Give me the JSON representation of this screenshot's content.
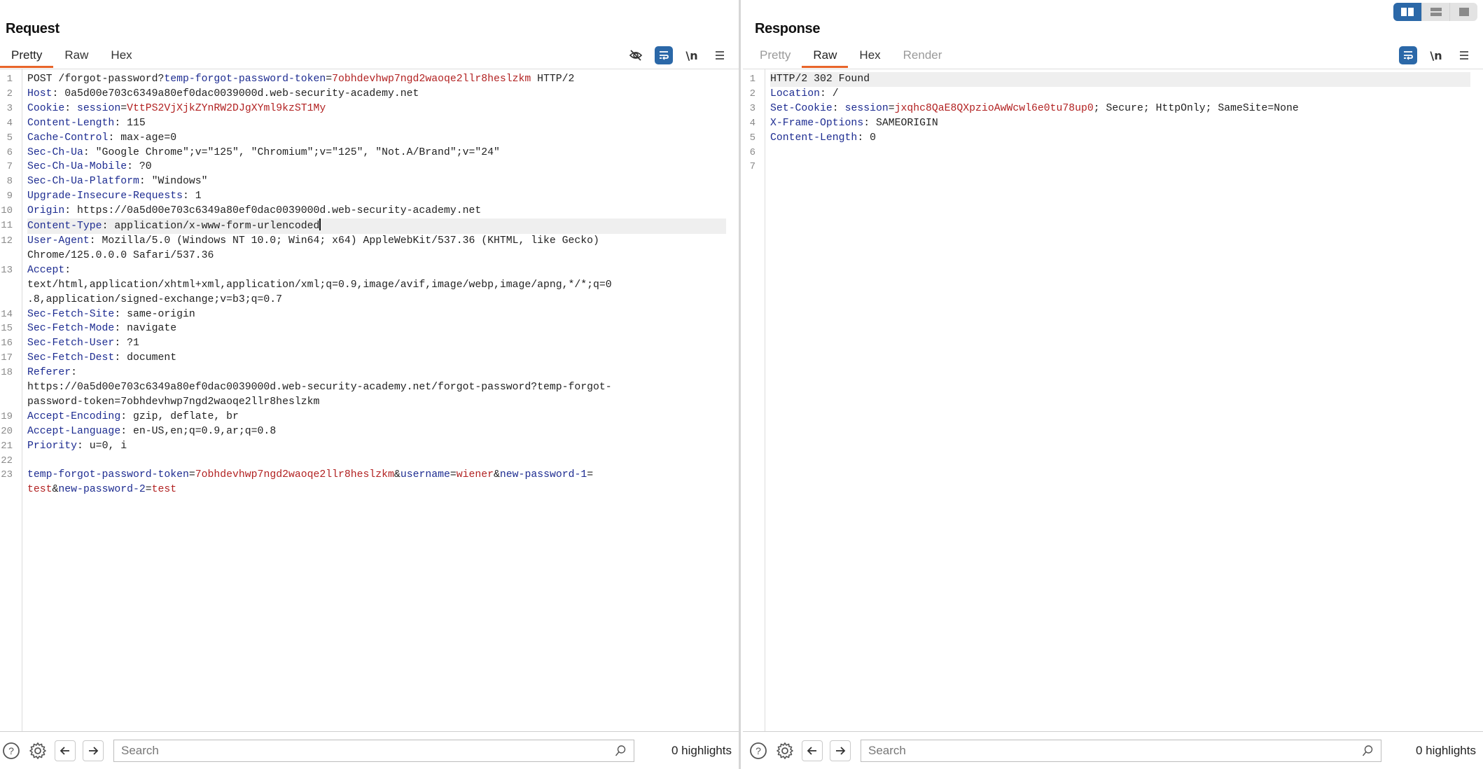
{
  "layout_toggle": {
    "options": [
      "side-by-side",
      "stacked-horizontal",
      "single"
    ],
    "active": "side-by-side"
  },
  "request": {
    "title": "Request",
    "tabs": [
      {
        "label": "Pretty",
        "active": true
      },
      {
        "label": "Raw",
        "active": false
      },
      {
        "label": "Hex",
        "active": false
      }
    ],
    "tools": {
      "hide_icon": "eye-slash-icon",
      "wrap_icon": "word-wrap-icon",
      "newline_label": "\\n",
      "menu_icon": "hamburger-menu-icon"
    },
    "lines": [
      {
        "n": "1",
        "parts": [
          [
            "v",
            "POST /forgot-password?"
          ],
          [
            "k",
            "temp-forgot-password-token"
          ],
          [
            "v",
            "="
          ],
          [
            "r",
            "7obhdevhwp7ngd2waoqe2llr8heslzkm"
          ],
          [
            "v",
            " HTTP/2"
          ]
        ]
      },
      {
        "n": "2",
        "parts": [
          [
            "k",
            "Host"
          ],
          [
            "v",
            ": 0a5d00e703c6349a80ef0dac0039000d.web-security-academy.net"
          ]
        ]
      },
      {
        "n": "3",
        "parts": [
          [
            "k",
            "Cookie"
          ],
          [
            "v",
            ": "
          ],
          [
            "k",
            "session"
          ],
          [
            "v",
            "="
          ],
          [
            "r",
            "VttPS2VjXjkZYnRW2DJgXYml9kzST1My"
          ]
        ]
      },
      {
        "n": "4",
        "parts": [
          [
            "k",
            "Content-Length"
          ],
          [
            "v",
            ": 115"
          ]
        ]
      },
      {
        "n": "5",
        "parts": [
          [
            "k",
            "Cache-Control"
          ],
          [
            "v",
            ": max-age=0"
          ]
        ]
      },
      {
        "n": "6",
        "parts": [
          [
            "k",
            "Sec-Ch-Ua"
          ],
          [
            "v",
            ": \"Google Chrome\";v=\"125\", \"Chromium\";v=\"125\", \"Not.A/Brand\";v=\"24\""
          ]
        ]
      },
      {
        "n": "7",
        "parts": [
          [
            "k",
            "Sec-Ch-Ua-Mobile"
          ],
          [
            "v",
            ": ?0"
          ]
        ]
      },
      {
        "n": "8",
        "parts": [
          [
            "k",
            "Sec-Ch-Ua-Platform"
          ],
          [
            "v",
            ": \"Windows\""
          ]
        ]
      },
      {
        "n": "9",
        "parts": [
          [
            "k",
            "Upgrade-Insecure-Requests"
          ],
          [
            "v",
            ": 1"
          ]
        ]
      },
      {
        "n": "10",
        "parts": [
          [
            "k",
            "Origin"
          ],
          [
            "v",
            ": https://0a5d00e703c6349a80ef0dac0039000d.web-security-academy.net"
          ]
        ]
      },
      {
        "n": "11",
        "highlight": true,
        "caret": true,
        "parts": [
          [
            "k",
            "Content-Type"
          ],
          [
            "v",
            ": application/x-www-form-urlencoded"
          ]
        ]
      },
      {
        "n": "12",
        "parts": [
          [
            "k",
            "User-Agent"
          ],
          [
            "v",
            ": Mozilla/5.0 (Windows NT 10.0; Win64; x64) AppleWebKit/537.36 (KHTML, like Gecko)\nChrome/125.0.0.0 Safari/537.36"
          ]
        ]
      },
      {
        "n": "13",
        "parts": [
          [
            "k",
            "Accept"
          ],
          [
            "v",
            ":\ntext/html,application/xhtml+xml,application/xml;q=0.9,image/avif,image/webp,image/apng,*/*;q=0\n.8,application/signed-exchange;v=b3;q=0.7"
          ]
        ]
      },
      {
        "n": "14",
        "parts": [
          [
            "k",
            "Sec-Fetch-Site"
          ],
          [
            "v",
            ": same-origin"
          ]
        ]
      },
      {
        "n": "15",
        "parts": [
          [
            "k",
            "Sec-Fetch-Mode"
          ],
          [
            "v",
            ": navigate"
          ]
        ]
      },
      {
        "n": "16",
        "parts": [
          [
            "k",
            "Sec-Fetch-User"
          ],
          [
            "v",
            ": ?1"
          ]
        ]
      },
      {
        "n": "17",
        "parts": [
          [
            "k",
            "Sec-Fetch-Dest"
          ],
          [
            "v",
            ": document"
          ]
        ]
      },
      {
        "n": "18",
        "parts": [
          [
            "k",
            "Referer"
          ],
          [
            "v",
            ":\nhttps://0a5d00e703c6349a80ef0dac0039000d.web-security-academy.net/forgot-password?temp-forgot-\npassword-token=7obhdevhwp7ngd2waoqe2llr8heslzkm"
          ]
        ]
      },
      {
        "n": "19",
        "parts": [
          [
            "k",
            "Accept-Encoding"
          ],
          [
            "v",
            ": gzip, deflate, br"
          ]
        ]
      },
      {
        "n": "20",
        "parts": [
          [
            "k",
            "Accept-Language"
          ],
          [
            "v",
            ": en-US,en;q=0.9,ar;q=0.8"
          ]
        ]
      },
      {
        "n": "21",
        "parts": [
          [
            "k",
            "Priority"
          ],
          [
            "v",
            ": u=0, i"
          ]
        ]
      },
      {
        "n": "22",
        "parts": []
      },
      {
        "n": "23",
        "parts": [
          [
            "k",
            "temp-forgot-password-token"
          ],
          [
            "v",
            "="
          ],
          [
            "r",
            "7obhdevhwp7ngd2waoqe2llr8heslzkm"
          ],
          [
            "v",
            "&"
          ],
          [
            "k",
            "username"
          ],
          [
            "v",
            "="
          ],
          [
            "r",
            "wiener"
          ],
          [
            "v",
            "&"
          ],
          [
            "k",
            "new-password-1"
          ],
          [
            "v",
            "=\n"
          ],
          [
            "r",
            "test"
          ],
          [
            "v",
            "&"
          ],
          [
            "k",
            "new-password-2"
          ],
          [
            "v",
            "="
          ],
          [
            "r",
            "test"
          ]
        ]
      }
    ],
    "search": {
      "placeholder": "Search",
      "value": ""
    },
    "highlights": "0 highlights"
  },
  "response": {
    "title": "Response",
    "tabs": [
      {
        "label": "Pretty",
        "active": false,
        "dim": true
      },
      {
        "label": "Raw",
        "active": true
      },
      {
        "label": "Hex",
        "active": false
      },
      {
        "label": "Render",
        "active": false,
        "dim": true
      }
    ],
    "tools": {
      "wrap_icon": "word-wrap-icon",
      "newline_label": "\\n",
      "menu_icon": "hamburger-menu-icon"
    },
    "lines": [
      {
        "n": "1",
        "highlight": true,
        "parts": [
          [
            "v",
            "HTTP/2 302 Found"
          ]
        ]
      },
      {
        "n": "2",
        "parts": [
          [
            "k",
            "Location"
          ],
          [
            "v",
            ": /"
          ]
        ]
      },
      {
        "n": "3",
        "parts": [
          [
            "k",
            "Set-Cookie"
          ],
          [
            "v",
            ": "
          ],
          [
            "k",
            "session"
          ],
          [
            "v",
            "="
          ],
          [
            "r",
            "jxqhc8QaE8QXpzioAwWcwl6e0tu78up0"
          ],
          [
            "v",
            "; Secure; HttpOnly; SameSite=None"
          ]
        ]
      },
      {
        "n": "4",
        "parts": [
          [
            "k",
            "X-Frame-Options"
          ],
          [
            "v",
            ": SAMEORIGIN"
          ]
        ]
      },
      {
        "n": "5",
        "parts": [
          [
            "k",
            "Content-Length"
          ],
          [
            "v",
            ": 0"
          ]
        ]
      },
      {
        "n": "6",
        "parts": []
      },
      {
        "n": "7",
        "parts": []
      }
    ],
    "search": {
      "placeholder": "Search",
      "value": ""
    },
    "highlights": "0 highlights"
  },
  "colors": {
    "accent_tab": "#e8652a",
    "active_tool": "#2b68a8",
    "header_key": "#1d2c91",
    "param_value": "#b22222"
  }
}
